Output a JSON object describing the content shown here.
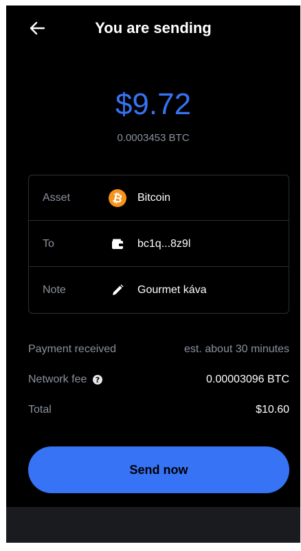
{
  "header": {
    "title": "You are sending",
    "back_icon": "arrow-left-icon"
  },
  "amount": {
    "fiat": "$9.72",
    "crypto": "0.0003453 BTC",
    "color": "#3773f5"
  },
  "details": {
    "asset": {
      "label": "Asset",
      "value": "Bitcoin",
      "icon": "bitcoin-icon",
      "icon_color": "#f7931a"
    },
    "to": {
      "label": "To",
      "value": "bc1q...8z9l",
      "icon": "wallet-icon"
    },
    "note": {
      "label": "Note",
      "value": "Gourmet káva",
      "icon": "pencil-icon"
    }
  },
  "summary": {
    "payment_received": {
      "label": "Payment received",
      "value": "est. about 30 minutes"
    },
    "network_fee": {
      "label": "Network fee",
      "value": "0.00003096 BTC",
      "icon": "help-icon"
    },
    "total": {
      "label": "Total",
      "value": "$10.60"
    }
  },
  "actions": {
    "send_label": "Send now"
  },
  "colors": {
    "background": "#000000",
    "accent": "#3773f5",
    "muted_text": "#8a919e",
    "border": "#2c2f36"
  }
}
